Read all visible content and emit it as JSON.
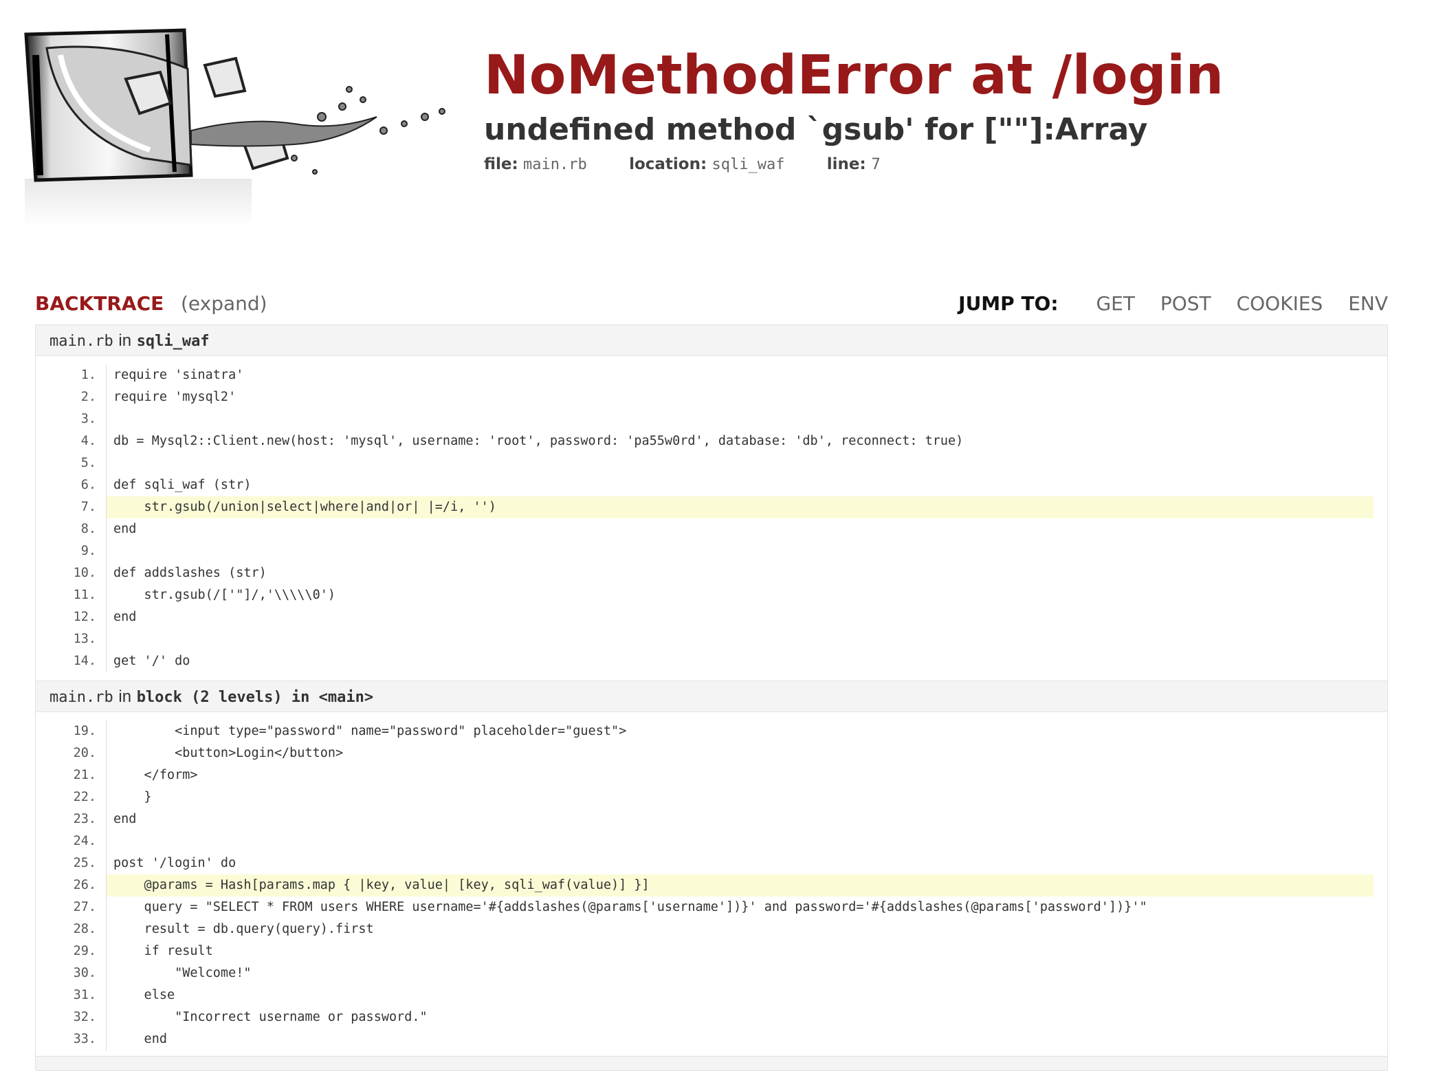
{
  "header": {
    "title": "NoMethodError at /login",
    "subtitle": "undefined method `gsub' for [\"\"]:Array",
    "file_label": "file:",
    "file_value": "main.rb",
    "location_label": "location:",
    "location_value": "sqli_waf",
    "line_label": "line:",
    "line_value": "7"
  },
  "nav": {
    "backtrace": "BACKTRACE",
    "expand": "(expand)",
    "jump_to": "JUMP TO:",
    "links": [
      "GET",
      "POST",
      "COOKIES",
      "ENV"
    ]
  },
  "frames": [
    {
      "file": "main.rb",
      "in": "in",
      "function": "sqli_waf",
      "lines": [
        {
          "n": "1.",
          "code": "require 'sinatra'",
          "highlight": false
        },
        {
          "n": "2.",
          "code": "require 'mysql2'",
          "highlight": false
        },
        {
          "n": "3.",
          "code": "",
          "highlight": false
        },
        {
          "n": "4.",
          "code": "db = Mysql2::Client.new(host: 'mysql', username: 'root', password: 'pa55w0rd', database: 'db', reconnect: true)",
          "highlight": false
        },
        {
          "n": "5.",
          "code": "",
          "highlight": false
        },
        {
          "n": "6.",
          "code": "def sqli_waf (str)",
          "highlight": false
        },
        {
          "n": "7.",
          "code": "    str.gsub(/union|select|where|and|or| |=/i, '')",
          "highlight": true
        },
        {
          "n": "8.",
          "code": "end",
          "highlight": false
        },
        {
          "n": "9.",
          "code": "",
          "highlight": false
        },
        {
          "n": "10.",
          "code": "def addslashes (str)",
          "highlight": false
        },
        {
          "n": "11.",
          "code": "    str.gsub(/['\"]/,'\\\\\\\\\\0')",
          "highlight": false
        },
        {
          "n": "12.",
          "code": "end",
          "highlight": false
        },
        {
          "n": "13.",
          "code": "",
          "highlight": false
        },
        {
          "n": "14.",
          "code": "get '/' do",
          "highlight": false
        }
      ]
    },
    {
      "file": "main.rb",
      "in": "in",
      "function": "block (2 levels) in <main>",
      "lines": [
        {
          "n": "19.",
          "code": "        <input type=\"password\" name=\"password\" placeholder=\"guest\">",
          "highlight": false
        },
        {
          "n": "20.",
          "code": "        <button>Login</button>",
          "highlight": false
        },
        {
          "n": "21.",
          "code": "    </form>",
          "highlight": false
        },
        {
          "n": "22.",
          "code": "    }",
          "highlight": false
        },
        {
          "n": "23.",
          "code": "end",
          "highlight": false
        },
        {
          "n": "24.",
          "code": "",
          "highlight": false
        },
        {
          "n": "25.",
          "code": "post '/login' do",
          "highlight": false
        },
        {
          "n": "26.",
          "code": "    @params = Hash[params.map { |key, value| [key, sqli_waf(value)] }]",
          "highlight": true
        },
        {
          "n": "27.",
          "code": "    query = \"SELECT * FROM users WHERE username='#{addslashes(@params['username'])}' and password='#{addslashes(@params['password'])}'\"",
          "highlight": false
        },
        {
          "n": "28.",
          "code": "    result = db.query(query).first",
          "highlight": false
        },
        {
          "n": "29.",
          "code": "    if result",
          "highlight": false
        },
        {
          "n": "30.",
          "code": "        \"Welcome!\"",
          "highlight": false
        },
        {
          "n": "31.",
          "code": "    else",
          "highlight": false
        },
        {
          "n": "32.",
          "code": "        \"Incorrect username or password.\"",
          "highlight": false
        },
        {
          "n": "33.",
          "code": "    end",
          "highlight": false
        }
      ]
    }
  ]
}
